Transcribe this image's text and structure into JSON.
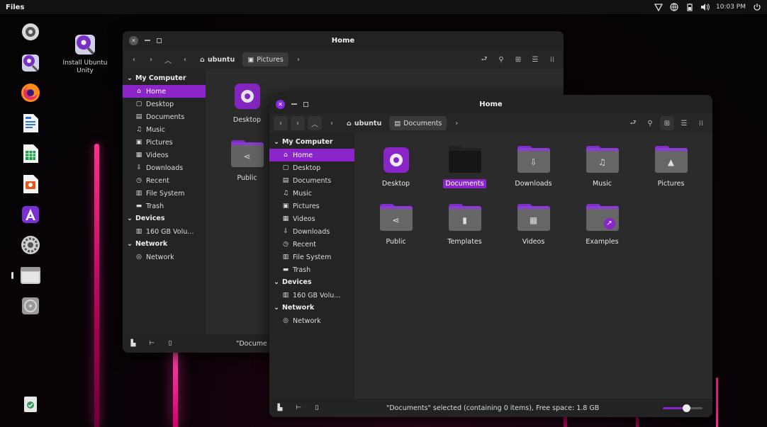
{
  "topbar": {
    "app_name": "Files",
    "clock": "10:03 PM",
    "icons": [
      "network-icon",
      "globe-icon",
      "battery-icon",
      "volume-icon",
      "power-icon"
    ]
  },
  "dock": {
    "items": [
      {
        "name": "dock-disk-utility",
        "icon": "disk-icon"
      },
      {
        "name": "dock-install-ubuntu",
        "icon": "installer-icon"
      },
      {
        "name": "dock-firefox",
        "icon": "firefox-icon"
      },
      {
        "name": "dock-writer",
        "icon": "writer-icon"
      },
      {
        "name": "dock-calc",
        "icon": "calc-icon"
      },
      {
        "name": "dock-impress",
        "icon": "impress-icon"
      },
      {
        "name": "dock-app-center",
        "icon": "app-center-icon"
      },
      {
        "name": "dock-settings",
        "icon": "settings-icon"
      },
      {
        "name": "dock-files",
        "icon": "files-icon",
        "running": true
      },
      {
        "name": "dock-optical-drive",
        "icon": "optical-drive-icon"
      }
    ],
    "trash_icon": "trash-icon"
  },
  "desktop": {
    "icon_label": "Install Ubuntu Unity"
  },
  "back_window": {
    "title": "Home",
    "crumb_root": "ubuntu",
    "crumb_current": "Pictures",
    "sidebar": {
      "my_computer": "My Computer",
      "items": [
        "Home",
        "Desktop",
        "Documents",
        "Music",
        "Pictures",
        "Videos",
        "Downloads",
        "Recent",
        "File System",
        "Trash"
      ],
      "devices": "Devices",
      "device_items": [
        "160 GB Volu..."
      ],
      "network": "Network",
      "network_items": [
        "Network"
      ]
    },
    "tiles": [
      "Desktop",
      "Public"
    ],
    "status": "\"Docume"
  },
  "front_window": {
    "title": "Home",
    "crumb_root": "ubuntu",
    "crumb_current": "Documents",
    "sidebar": {
      "my_computer": "My Computer",
      "items": [
        "Home",
        "Desktop",
        "Documents",
        "Music",
        "Pictures",
        "Videos",
        "Downloads",
        "Recent",
        "File System",
        "Trash"
      ],
      "devices": "Devices",
      "device_items": [
        "160 GB Volu..."
      ],
      "network": "Network",
      "network_items": [
        "Network"
      ]
    },
    "tiles": [
      "Desktop",
      "Documents",
      "Downloads",
      "Music",
      "Pictures",
      "Public",
      "Templates",
      "Videos",
      "Examples"
    ],
    "selected": "Documents",
    "status": "\"Documents\" selected (containing 0 items), Free space: 1.8 GB",
    "zoom_level": 0.6
  },
  "colors": {
    "accent": "#8a25c9",
    "beam": "#ff2f93"
  }
}
